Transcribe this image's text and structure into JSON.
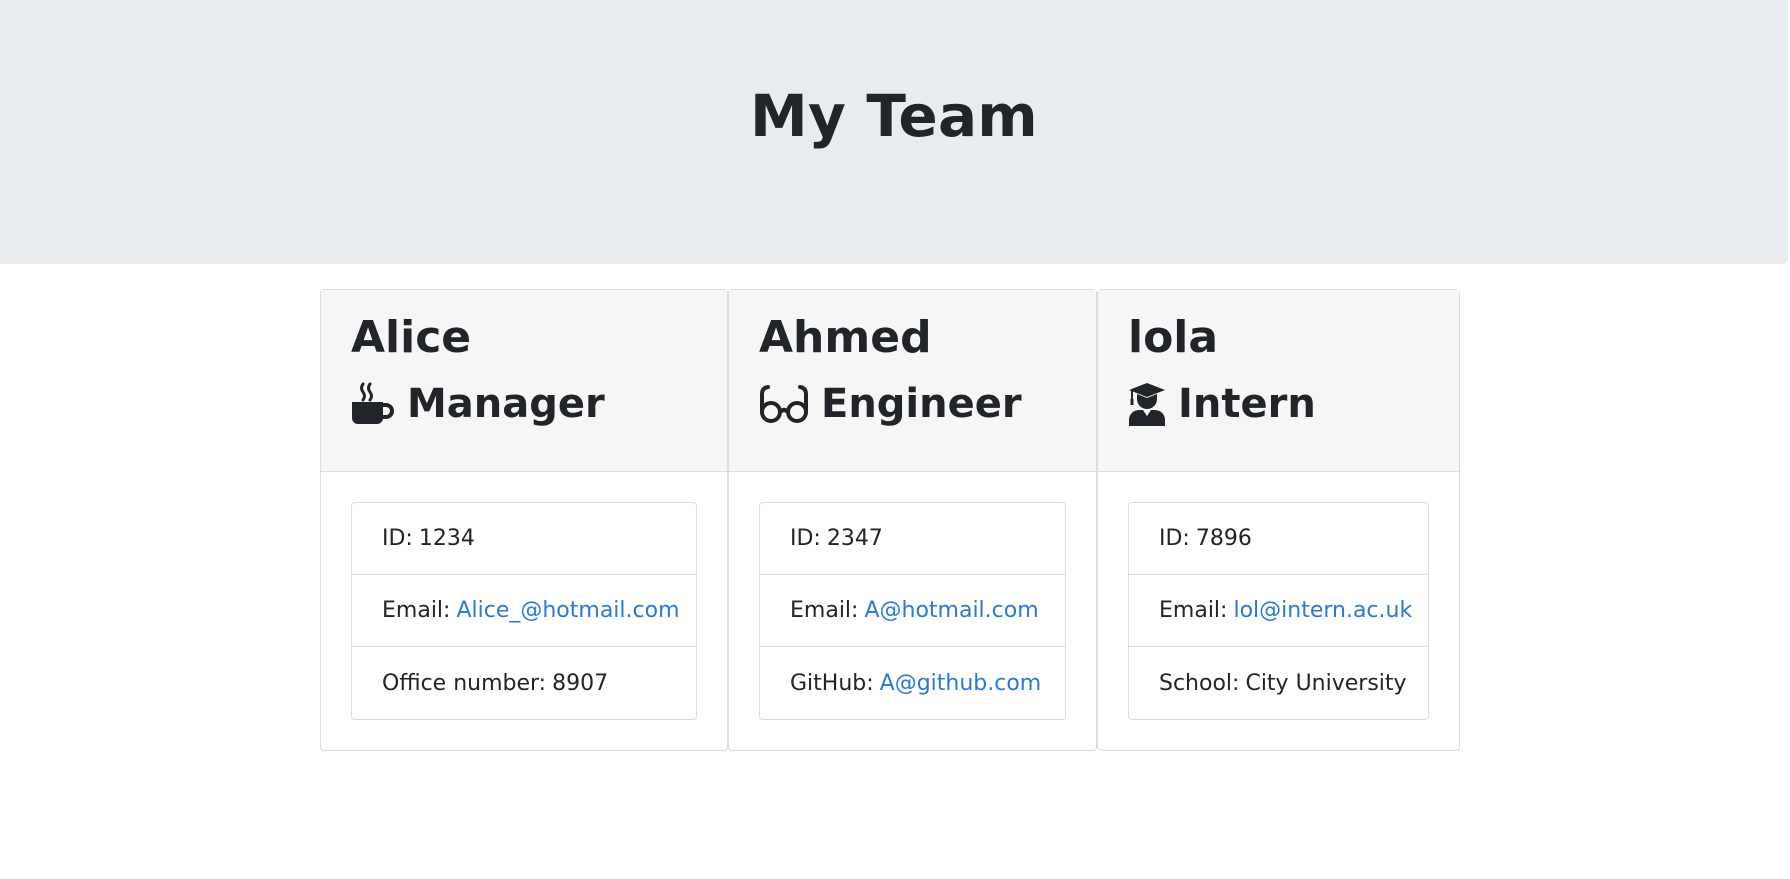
{
  "header": {
    "title": "My Team"
  },
  "colors": {
    "jumbotron_bg": "#e9ecef",
    "link": "#2a7ad5",
    "text": "#212529"
  },
  "employees": [
    {
      "name": "Alice",
      "role": "Manager",
      "role_icon": "mug-hot-icon",
      "id_label": "ID:",
      "id": "1234",
      "email_label": "Email:",
      "email": "Alice_@hotmail.com",
      "extra_label": "Office number:",
      "extra_value": "8907"
    },
    {
      "name": "Ahmed",
      "role": "Engineer",
      "role_icon": "glasses-icon",
      "id_label": "ID:",
      "id": "2347",
      "email_label": "Email:",
      "email": "A@hotmail.com",
      "extra_label": "GitHub:",
      "extra_value": "A@github.com"
    },
    {
      "name": "lola",
      "role": "Intern",
      "role_icon": "user-graduate-icon",
      "id_label": "ID:",
      "id": "7896",
      "email_label": "Email:",
      "email": "lol@intern.ac.uk",
      "extra_label": "School:",
      "extra_value": "City University"
    }
  ]
}
